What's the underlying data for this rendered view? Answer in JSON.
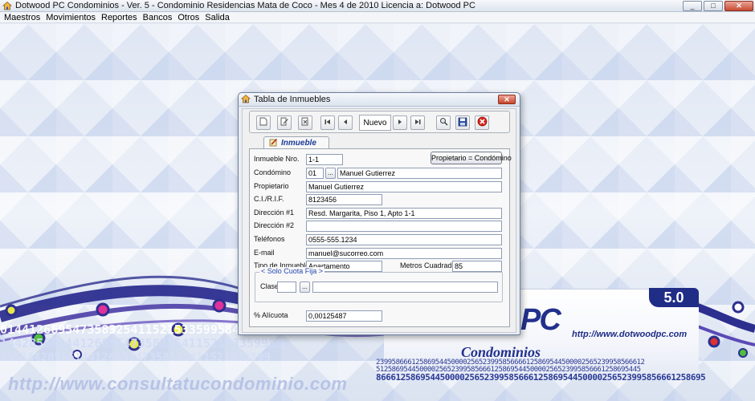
{
  "window": {
    "title": "Dotwood PC Condominios - Ver. 5  - Condominio Residencias Mata de Coco  -  Mes 4 de 2010    Licencia a: Dotwood PC",
    "controls": {
      "minimize": "_",
      "maximize": "□",
      "close": "✕"
    }
  },
  "menu": {
    "items": [
      "Maestros",
      "Movimientos",
      "Reportes",
      "Bancos",
      "Otros",
      "Salida"
    ]
  },
  "background": {
    "url_text": "http://www.consultatucondominio.com",
    "number_lines": [
      "0144126695473583254115215335995844111220",
      "1442856614412669547358325411521533599584",
      "6953442856614412669547358325411521533599"
    ]
  },
  "product_card": {
    "version": "5.0",
    "logo_text": "PC",
    "product_name": "Condominios",
    "url": "http://www.dotwoodpc.com",
    "digit_lines": [
      "23995866612586954450000256523995856666125869544500002565239958566612",
      "5125869544500002565239958566612586954450000256523995856661258695445",
      "8666125869544500002565239958566612586954450000256523995856661258695"
    ]
  },
  "dialog": {
    "title": "Tabla de Inmuebles",
    "toolbar": {
      "record_status": "Nuevo",
      "icons": [
        "new-icon",
        "edit-icon",
        "delete-icon",
        "first-record-icon",
        "previous-record-icon",
        "next-record-icon",
        "last-record-icon",
        "search-icon",
        "save-icon",
        "cancel-icon"
      ]
    },
    "tab_label": "Inmueble",
    "owner_button": "Propietario = Condómino",
    "labels": {
      "inmueble_nro": "Inmueble Nro.",
      "condomino": "Condómino",
      "propietario": "Propietario",
      "cirif": "C.I./R.I.F.",
      "direccion1": "Dirección #1",
      "direccion2": "Dirección #2",
      "telefonos": "Teléfonos",
      "email": "E-mail",
      "tipo_inmueble": "Tipo de Inmueble",
      "metros": "Metros Cuadrados",
      "group_title": "< Solo Cuota Fija >",
      "clase": "Clase",
      "alicuota": "% Alícuota"
    },
    "values": {
      "inmueble_nro": "1-1",
      "condomino_code": "01",
      "condomino_name": "Manuel Gutierrez",
      "propietario": "Manuel Gutierrez",
      "cirif": "8123456",
      "direccion1": "Resd. Margarita, Piso 1, Apto 1-1",
      "direccion2": "",
      "telefonos": "0555-555.1234",
      "email": "manuel@sucorreo.com",
      "tipo_inmueble": "Apartamento",
      "metros": "85",
      "clase_code": "",
      "clase_desc": "",
      "alicuota": "0,00125487"
    },
    "lookup_button": "..."
  },
  "colors": {
    "brand": "#21308c",
    "accent": "#1f2d86",
    "url_text": "#b7c3e6"
  }
}
